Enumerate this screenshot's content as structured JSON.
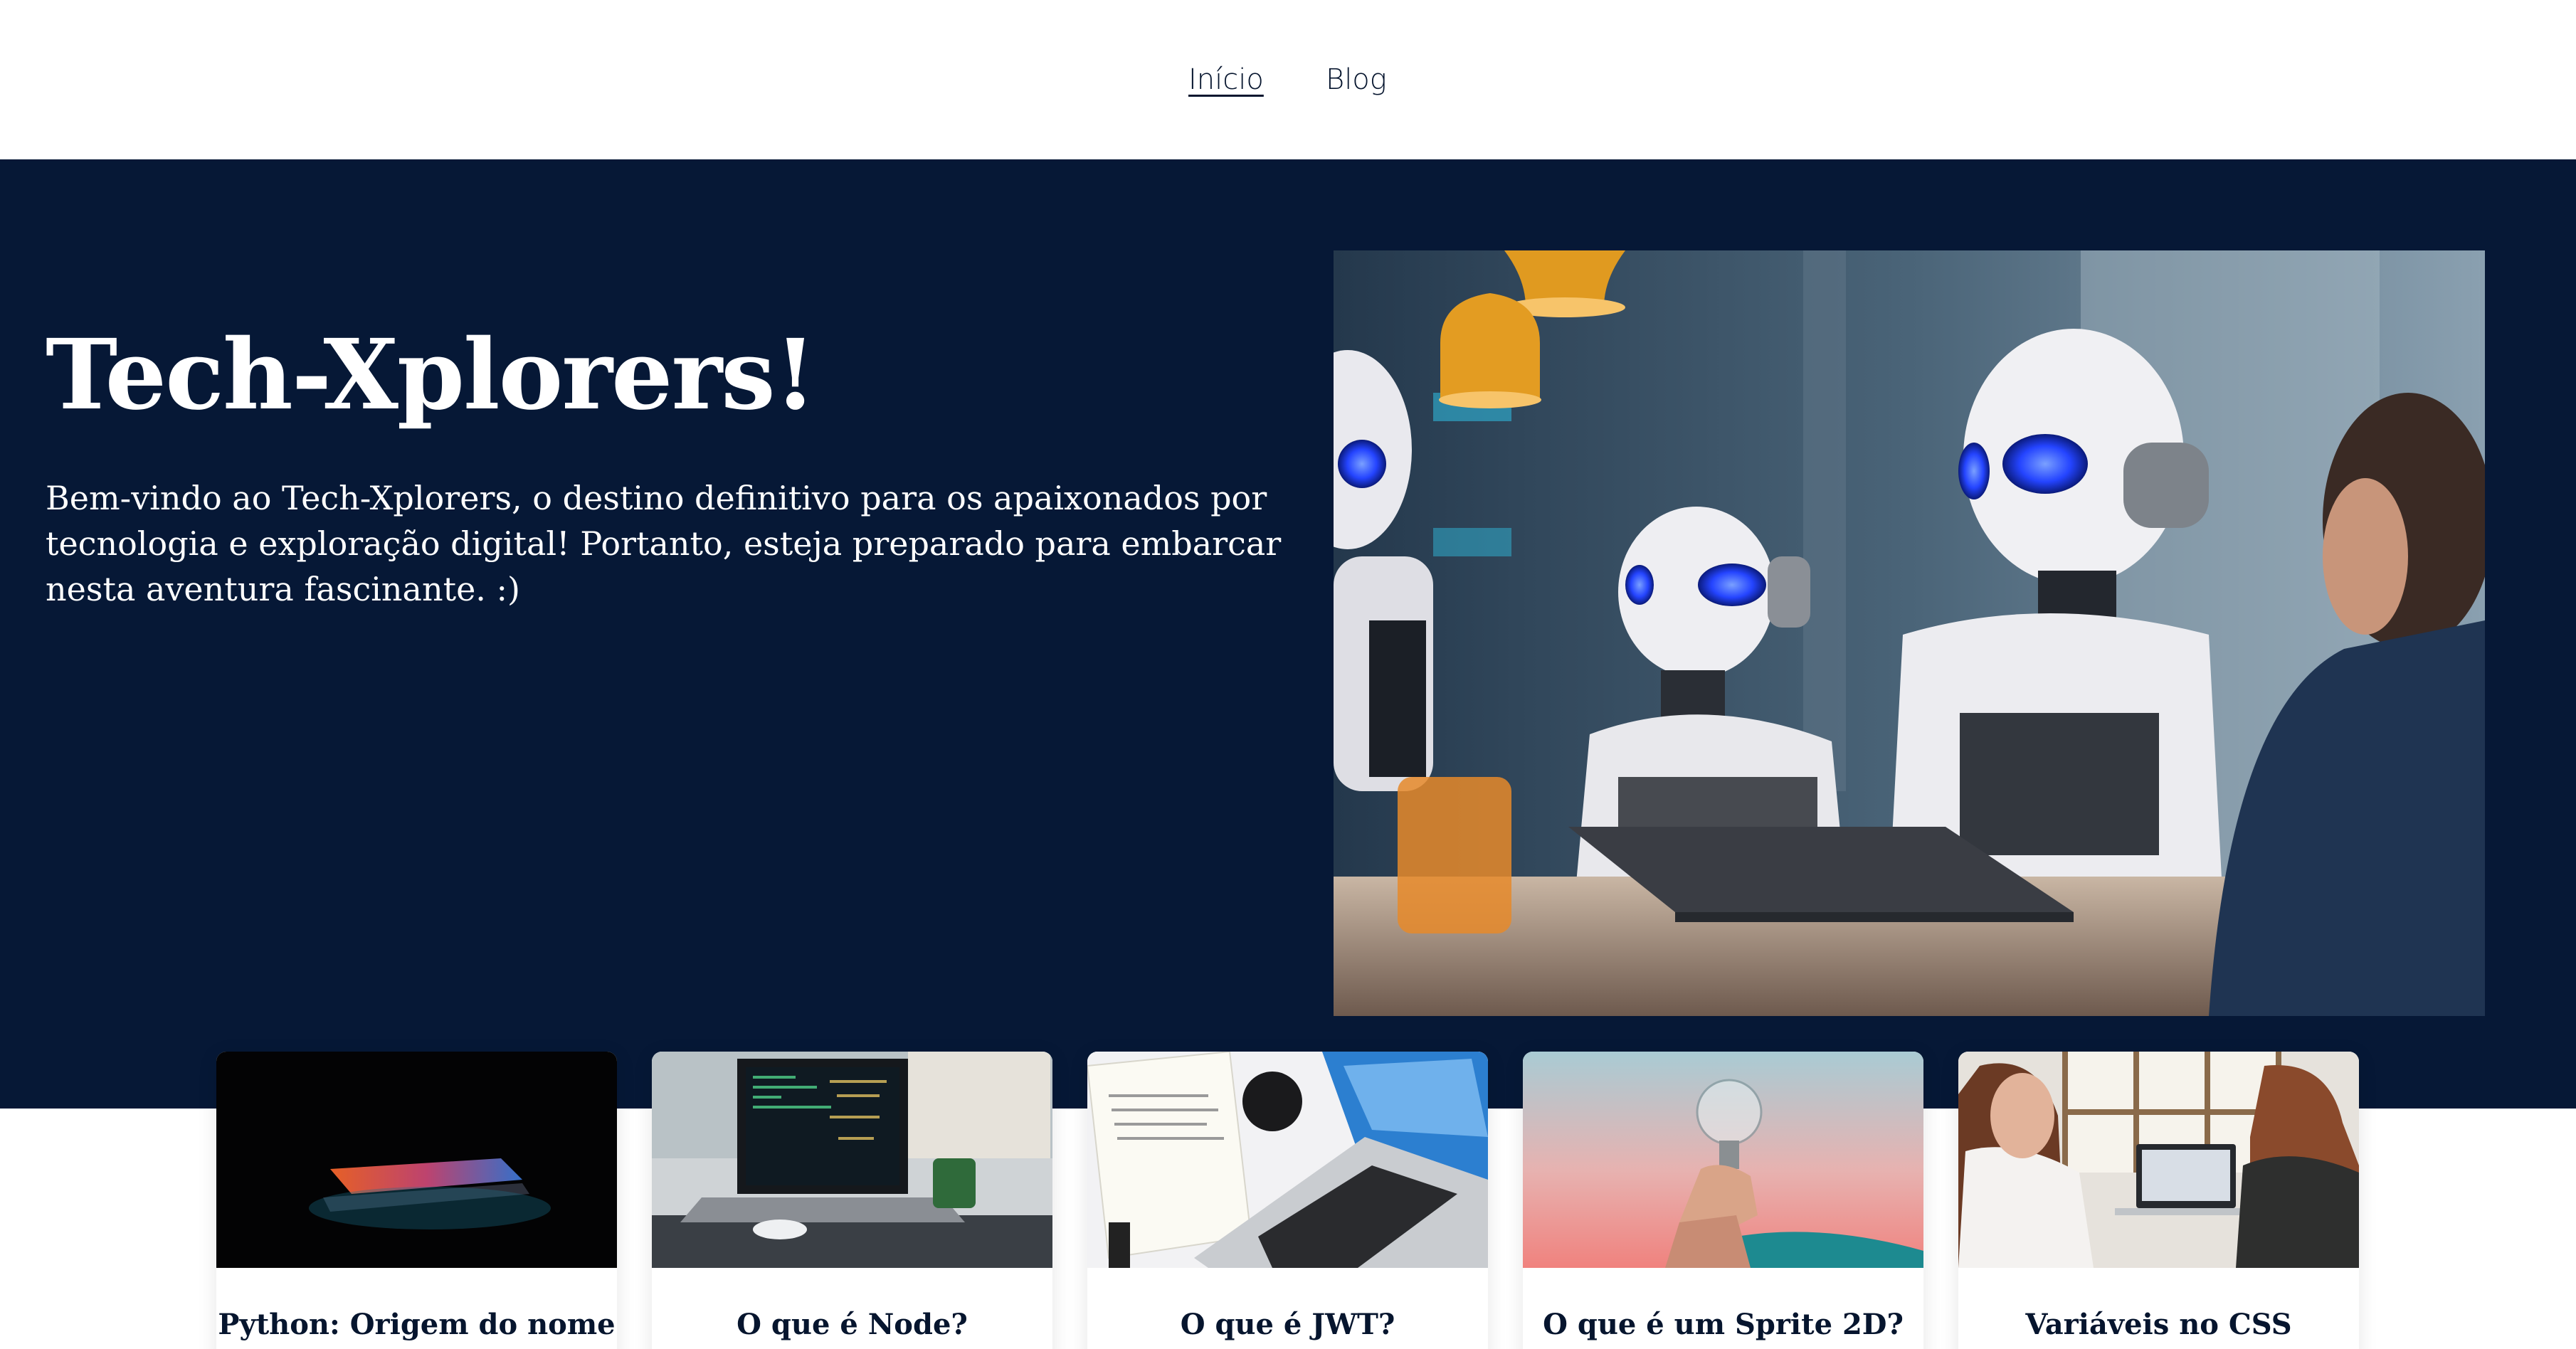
{
  "nav": {
    "items": [
      {
        "label": "Início",
        "active": true
      },
      {
        "label": "Blog",
        "active": false
      }
    ]
  },
  "hero": {
    "title": "Tech-Xplorers!",
    "text": "Bem-vindo ao Tech-Xplorers, o destino definitivo para os apaixonados por tecnologia e exploração digital! Portanto, esteja preparado para embarcar nesta aventura fascinante. :)",
    "image": "robots-in-office-photo"
  },
  "posts": [
    {
      "title": "Python: Origem do nome",
      "image": "laptop-glow-photo"
    },
    {
      "title": "O que é Node?",
      "image": "laptop-code-photo"
    },
    {
      "title": "O que é JWT?",
      "image": "desk-laptop-photo"
    },
    {
      "title": "O que é um Sprite 2D?",
      "image": "lightbulb-photo"
    },
    {
      "title": "Variáveis no CSS",
      "image": "people-computer-photo"
    }
  ],
  "colors": {
    "hero_background": "#061836",
    "text_dark": "#06152e",
    "page_background": "#ffffff"
  }
}
